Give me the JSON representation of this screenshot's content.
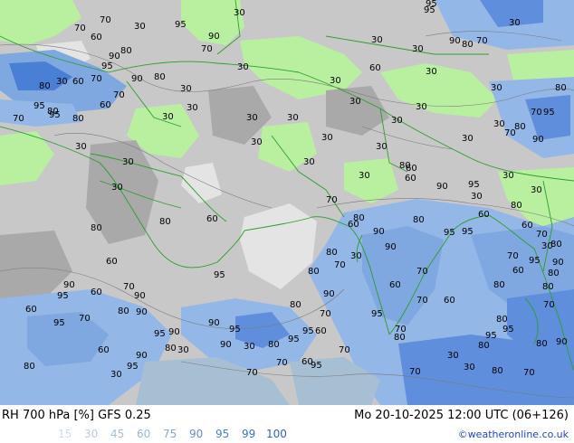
{
  "header": {
    "title_left": "RH 700 hPa [%] GFS 0.25",
    "title_right": "Mo 20-10-2025 12:00 UTC (06+126)",
    "credit": "©weatheronline.co.uk"
  },
  "legend": [
    {
      "label": "15",
      "color": "#c9dde9"
    },
    {
      "label": "30",
      "color": "#b7ccdc"
    },
    {
      "label": "45",
      "color": "#a6bfd3"
    },
    {
      "label": "60",
      "color": "#93b7e6"
    },
    {
      "label": "75",
      "color": "#7fa7e0"
    },
    {
      "label": "90",
      "color": "#5f8fdc"
    },
    {
      "label": "95",
      "color": "#4a7fd6"
    },
    {
      "label": "99",
      "color": "#3a6fd0"
    },
    {
      "label": "100",
      "color": "#2f5fc8"
    }
  ],
  "contour_labels": [
    "30",
    "70",
    "95",
    "30",
    "90",
    "95",
    "30",
    "70",
    "60",
    "80",
    "90",
    "30",
    "95",
    "70",
    "30",
    "90",
    "80",
    "70",
    "60",
    "30",
    "95",
    "30",
    "90",
    "80",
    "70",
    "30",
    "60",
    "30",
    "80",
    "30",
    "30",
    "70",
    "80",
    "30",
    "95",
    "80",
    "60",
    "70",
    "30",
    "30",
    "30",
    "30",
    "30",
    "70",
    "95",
    "95",
    "80",
    "30",
    "30",
    "80",
    "70",
    "90",
    "30",
    "30",
    "30",
    "30",
    "30",
    "30",
    "30",
    "30",
    "80",
    "60",
    "30",
    "30",
    "90",
    "30",
    "60",
    "95",
    "30",
    "80",
    "60",
    "70",
    "80",
    "60",
    "90",
    "95",
    "70",
    "80",
    "60",
    "95",
    "30",
    "80",
    "95",
    "30",
    "60",
    "80",
    "90",
    "80",
    "70",
    "70",
    "60",
    "95",
    "80",
    "90",
    "80",
    "60",
    "70",
    "80",
    "90",
    "60",
    "80",
    "70",
    "80",
    "60",
    "90",
    "95",
    "90",
    "70",
    "60",
    "80",
    "70",
    "60",
    "80",
    "90",
    "95",
    "70",
    "70",
    "80",
    "95",
    "90",
    "70",
    "95",
    "95",
    "90",
    "95",
    "95",
    "80",
    "95",
    "60",
    "80",
    "90",
    "80",
    "90",
    "30",
    "80",
    "95",
    "80",
    "30",
    "70",
    "60",
    "90",
    "30",
    "60",
    "70",
    "95",
    "30",
    "80",
    "95",
    "70",
    "30",
    "70",
    "80",
    "70",
    "60",
    "95",
    "95"
  ]
}
